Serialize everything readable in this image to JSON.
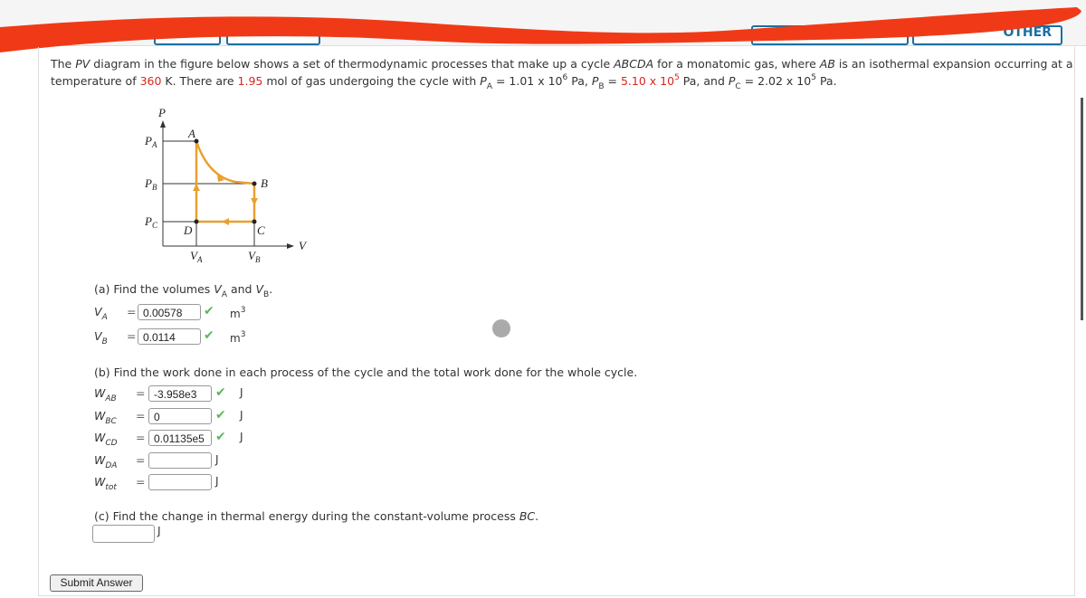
{
  "header": {
    "right_button_label": "OTHER"
  },
  "problem": {
    "line1_a": "The ",
    "pv": "PV",
    "line1_b": " diagram in the figure below shows a set of thermodynamic processes that make up a cycle ",
    "cycle": "ABCDA",
    "line1_c": " for a monatomic gas, where ",
    "ab": "AB",
    "line1_d": " is an isothermal expansion occurring at a",
    "line2_a": "temperature of ",
    "temperature": "360",
    "line2_b": " K. There are ",
    "moles": "1.95",
    "line2_c": " mol of gas undergoing the cycle with ",
    "PA": "1.01 x 10",
    "PA_exp": "6",
    "PB": "5.10 x 10",
    "PB_exp": "5",
    "PC": "2.02 x 10",
    "PC_exp": "5",
    "unit": "Pa"
  },
  "diagram": {
    "P": "P",
    "V": "V",
    "PA": "P",
    "PA_sub": "A",
    "PB": "P",
    "PB_sub": "B",
    "PC": "P",
    "PC_sub": "C",
    "VA": "V",
    "VA_sub": "A",
    "VB": "V",
    "VB_sub": "B",
    "A": "A",
    "B": "B",
    "C": "C",
    "D": "D",
    "line_color": "#e8a030"
  },
  "part_a": {
    "prompt": "(a) Find the volumes ",
    "and": " and ",
    "VA": "0.00578",
    "VB": "0.0114",
    "unit": "m",
    "unit_exp": "3"
  },
  "part_b": {
    "prompt": "(b) Find the work done in each process of the cycle and the total work done for the whole cycle.",
    "rows": [
      {
        "sym": "W",
        "sub": "AB",
        "value": "-3.958e3",
        "correct": true
      },
      {
        "sym": "W",
        "sub": "BC",
        "value": "0",
        "correct": true
      },
      {
        "sym": "W",
        "sub": "CD",
        "value": "0.01135e5",
        "correct": true
      },
      {
        "sym": "W",
        "sub": "DA",
        "value": "",
        "correct": false
      },
      {
        "sym": "W",
        "sub": "tot",
        "value": "",
        "correct": false
      }
    ],
    "unit": "J"
  },
  "part_c": {
    "prompt": "(c) Find the change in thermal energy during the constant-volume process ",
    "process": "BC",
    "unit": "J",
    "value": ""
  },
  "submit_label": "Submit Answer",
  "colors": {
    "given_value": "#d8261c",
    "check": "#5cb85c",
    "redaction": "#f03a17"
  }
}
